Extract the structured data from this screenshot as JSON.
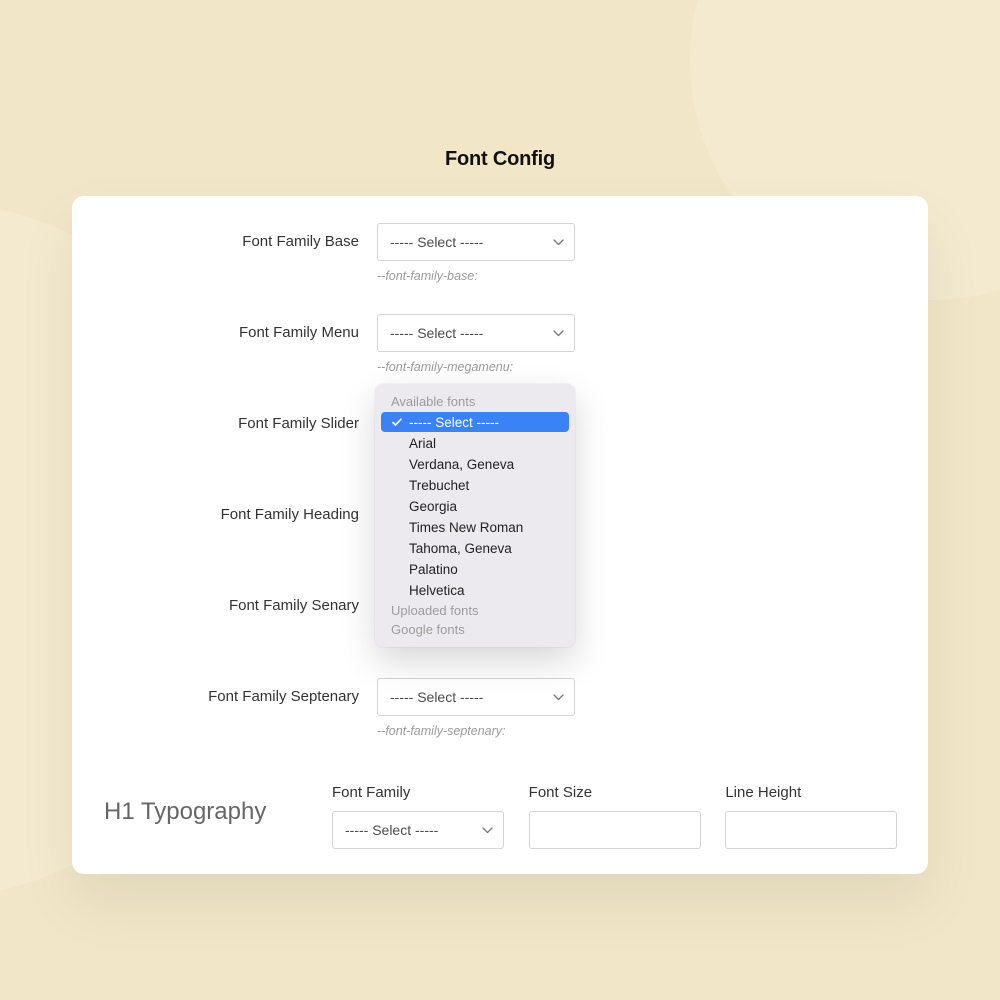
{
  "page_title": "Font Config",
  "select_placeholder": "----- Select -----",
  "fields": [
    {
      "label": "Font Family Base",
      "help": "--font-family-base:"
    },
    {
      "label": "Font Family Menu",
      "help": "--font-family-megamenu:"
    },
    {
      "label": "Font Family Slider",
      "help": ""
    },
    {
      "label": "Font Family Heading",
      "help": ""
    },
    {
      "label": "Font Family Senary",
      "help": ""
    },
    {
      "label": "Font Family Septenary",
      "help": "--font-family-septenary:"
    }
  ],
  "dropdown": {
    "group_available": "Available fonts",
    "group_uploaded": "Uploaded fonts",
    "group_google": "Google fonts",
    "items": [
      "----- Select -----",
      "Arial",
      "Verdana, Geneva",
      "Trebuchet",
      "Georgia",
      "Times New Roman",
      "Tahoma, Geneva",
      "Palatino",
      "Helvetica"
    ]
  },
  "h1": {
    "title": "H1 Typography",
    "font_family_label": "Font Family",
    "font_size_label": "Font Size",
    "line_height_label": "Line Height"
  }
}
